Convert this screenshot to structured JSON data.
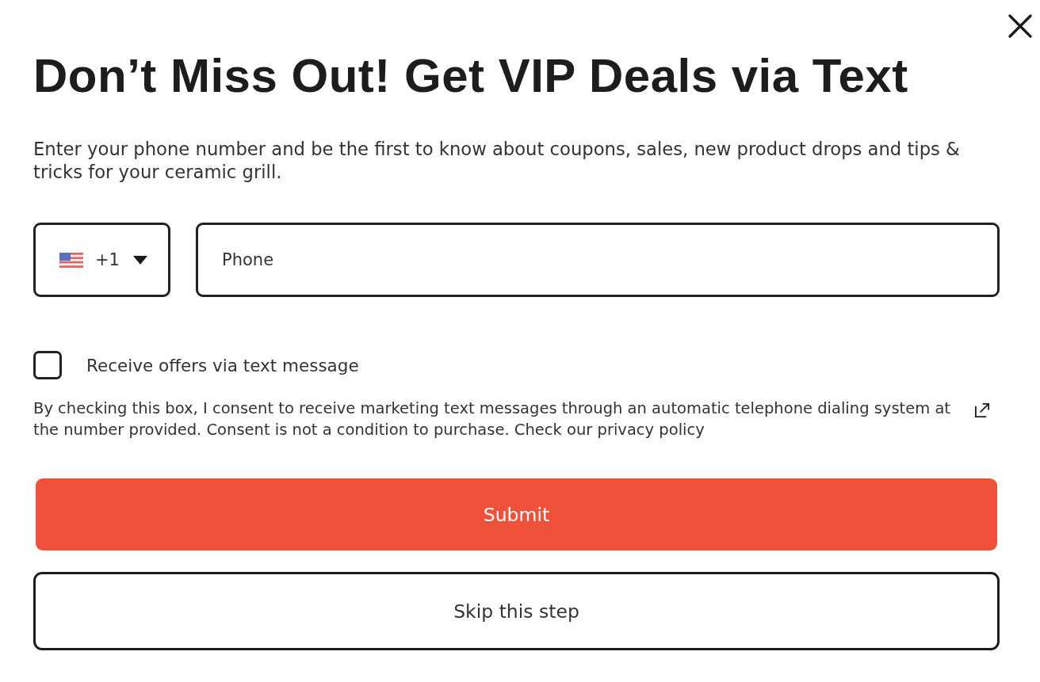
{
  "title": "Don’t Miss Out! Get VIP Deals via Text",
  "description": "Enter your phone number and be the first to know about coupons, sales, new product drops and tips & tricks for your ceramic grill.",
  "phone_form": {
    "country_code": {
      "value": "+1"
    },
    "phone": {
      "placeholder": "Phone"
    }
  },
  "consent": {
    "checkbox": {
      "label": "Receive offers via text message",
      "checked": false
    },
    "disclaimer": "By checking this box, I consent to receive marketing text messages through an automatic telephone dialing system at the number provided. Consent is not a condition to purchase. Check our privacy policy"
  },
  "buttons": [
    {
      "label": "Submit",
      "kind": "primary"
    },
    {
      "label": "Skip this step",
      "kind": "secondary"
    }
  ]
}
